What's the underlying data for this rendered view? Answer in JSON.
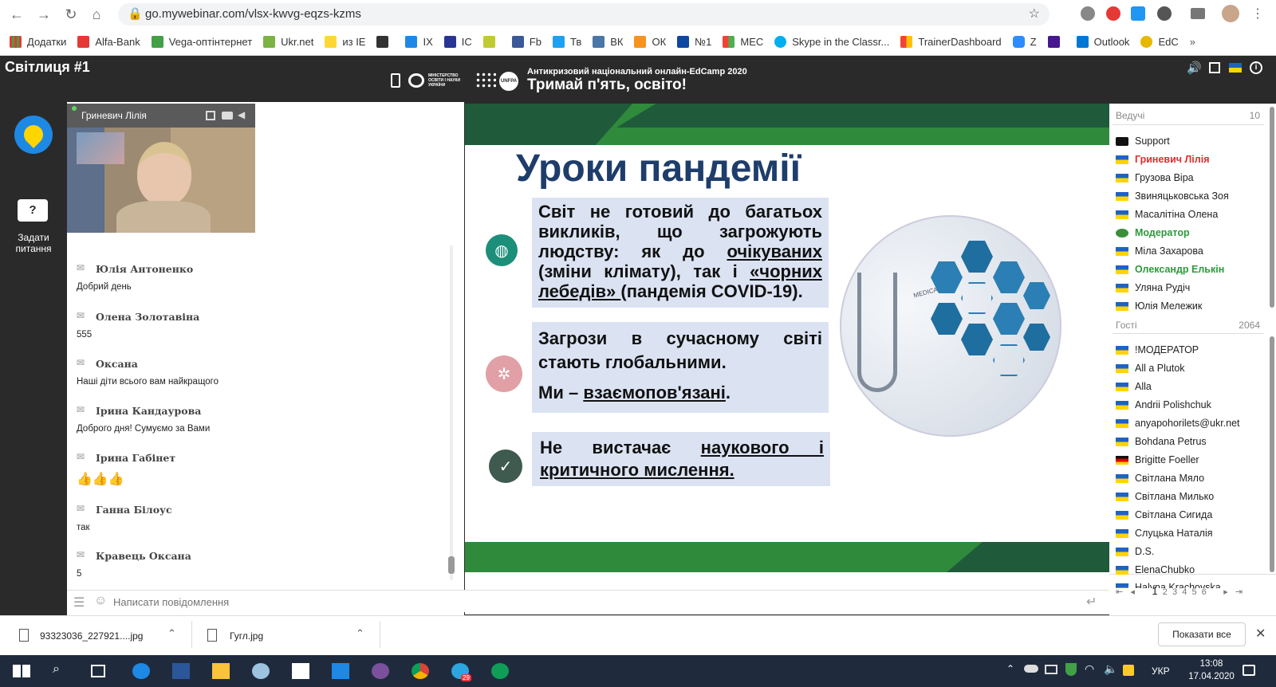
{
  "browser": {
    "url": "go.mywebinar.com/vlsx-kwvg-eqzs-kzms",
    "bookmarks": [
      "Додатки",
      "Alfa-Bank",
      "Vega-оптінтернет",
      "Ukr.net",
      "из IE",
      "IX",
      "IC",
      "Fb",
      "Тв",
      "ВК",
      "ОК",
      "№1",
      "МЕС",
      "Skype in the Classr...",
      "TrainerDashboard",
      "Z",
      "Outlook",
      "EdC"
    ]
  },
  "app": {
    "room_title": "Світлиця #1",
    "banner_line1": "Антикризовий національний онлайн-EdCamp 2020",
    "banner_line2": "Тримай п'ять, освіто!",
    "ministry": "МІНІСТЕРСТВО ОСВІТИ І НАУКИ УКРАЇНИ",
    "unfpa": "UNFPA",
    "ask_label": "Задати питання"
  },
  "video": {
    "name": "Гриневич Лілія"
  },
  "chat": {
    "messages": [
      {
        "name": "Юлія Антоненко",
        "text": "Добрий день"
      },
      {
        "name": "Олена Золотавіна",
        "text": "555"
      },
      {
        "name": "Оксана",
        "text": "Наші діти всього вам найкращого"
      },
      {
        "name": "Ірина Кандаурова",
        "text": "Доброго дня! Сумуємо за Вами"
      },
      {
        "name": "Ірина Габінет",
        "text": "👍👍👍"
      },
      {
        "name": "Ганна Білоус",
        "text": "так"
      },
      {
        "name": "Кравець Оксана",
        "text": "5"
      }
    ],
    "input_placeholder": "Написати повідомлення"
  },
  "slide": {
    "title": "Уроки пандемії",
    "b1_part1": "Світ не готовий до багатьох викликів, що загрожують людству: як до ",
    "b1_u1": "очікуваних",
    "b1_part2": " (зміни клімату), так і ",
    "b1_u2": "«чорних лебедів» ",
    "b1_part3": "(пандемія COVID-19).",
    "b2_line1": "Загрози в сучасному світі стають глобальними.",
    "b2_part1": "Ми – ",
    "b2_u1": "взаємопов'язані",
    "b2_part2": ".",
    "b3_part1": "Не вистачає ",
    "b3_u1": "наукового і критичного мислення.",
    "medical_label": "MEDICAL"
  },
  "participants": {
    "hosts_label": "Ведучі",
    "hosts_count": "10",
    "hosts": [
      {
        "name": "Support",
        "style": "normal"
      },
      {
        "name": "Гриневич Лілія",
        "style": "red"
      },
      {
        "name": "Грузова Віра",
        "style": "normal"
      },
      {
        "name": "Звиняцьковська Зоя",
        "style": "normal"
      },
      {
        "name": "Масалітіна Олена",
        "style": "normal"
      },
      {
        "name": "Модератор",
        "style": "green"
      },
      {
        "name": "Міла Захарова",
        "style": "normal"
      },
      {
        "name": "Олександр Елькін",
        "style": "green"
      },
      {
        "name": "Уляна Рудіч",
        "style": "normal"
      },
      {
        "name": "Юлія Мележик",
        "style": "normal"
      }
    ],
    "guests_label": "Гості",
    "guests_count": "2064",
    "guests": [
      "!МОДЕРАТОР",
      "All a Plutok",
      "Alla",
      "Andrii Polishchuk",
      "anyapohorilets@ukr.net",
      "Bohdana Petrus",
      "Brigitte Foeller",
      "Світлана Мяло",
      "Світлана Милько",
      "Світлана Сигида",
      "Слуцька Наталія",
      "D.S.",
      "ElenaChubko",
      "Halyna Krachovska"
    ],
    "pages": [
      "1",
      "2",
      "3",
      "4",
      "5",
      "6"
    ]
  },
  "downloads": {
    "files": [
      "93323036_227921....jpg",
      "Гугл.jpg"
    ],
    "show_all": "Показати все"
  },
  "taskbar": {
    "lang": "УКР",
    "time": "13:08",
    "date": "17.04.2020",
    "telegram_badge": "29"
  },
  "colors": {
    "dark_green": "#1f5b3a",
    "light_green": "#2f8a3c",
    "slide_title": "#1e3d6b",
    "box_bg": "#dbe3f3",
    "host_red": "#e32b2b",
    "host_green": "#2b9a3b",
    "taskbar": "#1f2b3d"
  }
}
